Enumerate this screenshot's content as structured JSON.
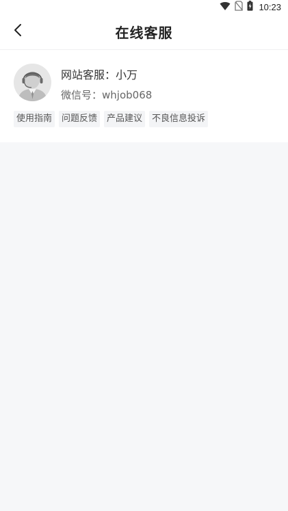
{
  "status_bar": {
    "time": "10:23",
    "icons": [
      "wifi-icon",
      "no-sim-icon",
      "battery-charging-icon"
    ]
  },
  "nav": {
    "title": "在线客服",
    "back_icon": "chevron-left-icon"
  },
  "service_card": {
    "avatar_icon": "customer-service-agent-icon",
    "agent_label": "网站客服：",
    "agent_name": "小万",
    "wechat_label": "微信号：",
    "wechat_id": "whjob068",
    "tags": [
      {
        "label": "使用指南"
      },
      {
        "label": "问题反馈"
      },
      {
        "label": "产品建议"
      },
      {
        "label": "不良信息投诉"
      }
    ]
  }
}
